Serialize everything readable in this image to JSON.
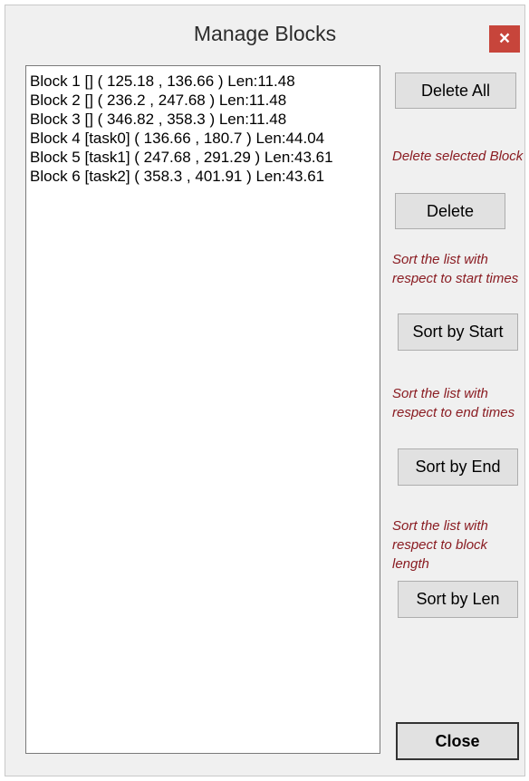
{
  "window": {
    "title": "Manage Blocks",
    "close_glyph": "×"
  },
  "blocks": [
    "Block 1 [] ( 125.18 , 136.66 ) Len:11.48",
    "Block 2 [] ( 236.2 , 247.68 ) Len:11.48",
    "Block 3 [] ( 346.82 , 358.3 ) Len:11.48",
    "Block 4 [task0] ( 136.66 , 180.7 ) Len:44.04",
    "Block 5 [task1] ( 247.68 , 291.29 ) Len:43.61",
    "Block 6 [task2] ( 358.3 , 401.91 ) Len:43.61"
  ],
  "actions": {
    "delete_all": "Delete All",
    "delete_hint": "Delete selected Block",
    "delete": "Delete",
    "sort_start_hint": "Sort the list with respect to start times",
    "sort_start": "Sort by Start",
    "sort_end_hint": "Sort the list with respect to end times",
    "sort_end": "Sort by End",
    "sort_len_hint": "Sort the list with respect to block length",
    "sort_len": "Sort by Len",
    "close": "Close"
  },
  "colors": {
    "hint_text": "#8a1c22",
    "close_button_bg": "#c7453b"
  }
}
